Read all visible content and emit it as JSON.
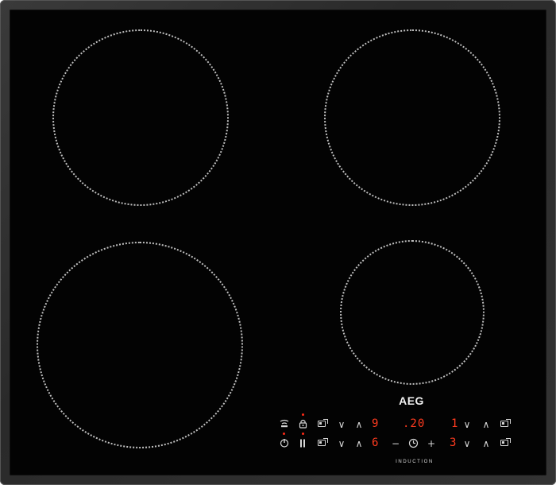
{
  "brand": {
    "logo": "AEG",
    "subtitle": "INDUCTION"
  },
  "zones": [
    {
      "name": "front-left"
    },
    {
      "name": "rear-left"
    },
    {
      "name": "rear-right"
    },
    {
      "name": "front-right"
    }
  ],
  "controls": {
    "row_top": {
      "zone_left_level": "9",
      "timer_display": ".20",
      "zone_right_level": "1"
    },
    "row_bottom": {
      "zone_left_level": "6",
      "zone_right_level": "3"
    },
    "glyphs": {
      "down": "∨",
      "up": "∧",
      "minus": "−",
      "plus": "+",
      "power": "⏻",
      "pause": "ll",
      "lock": "🔒"
    }
  },
  "colors": {
    "glass": "#030303",
    "frame": "#333333",
    "display_red": "#ff3b1f",
    "marking": "#ffffff"
  }
}
